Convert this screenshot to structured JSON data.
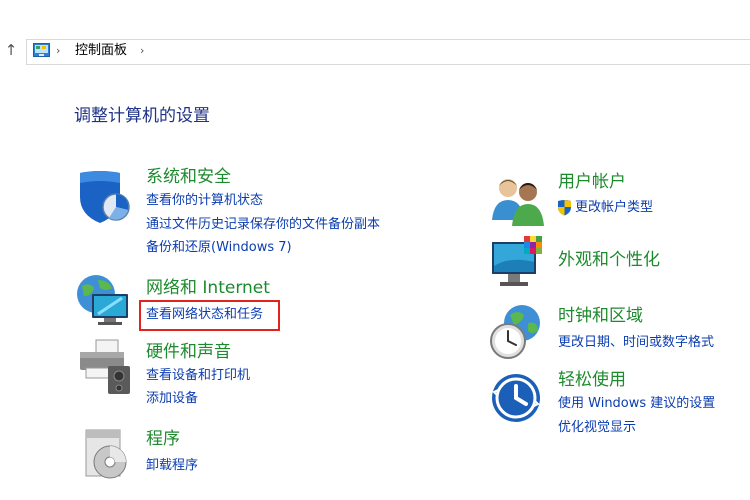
{
  "nav": {
    "breadcrumb": [
      "控制面板"
    ],
    "up_glyph": "↑",
    "separator_glyph": "›"
  },
  "page": {
    "title": "调整计算机的设置"
  },
  "categories": {
    "system_security": {
      "title": "系统和安全",
      "links": [
        "查看你的计算机状态",
        "通过文件历史记录保存你的文件备份副本",
        "备份和还原(Windows 7)"
      ]
    },
    "network": {
      "title": "网络和 Internet",
      "links": [
        "查看网络状态和任务"
      ]
    },
    "hardware": {
      "title": "硬件和声音",
      "links": [
        "查看设备和打印机",
        "添加设备"
      ]
    },
    "programs": {
      "title": "程序",
      "links": [
        "卸载程序"
      ]
    },
    "user_accounts": {
      "title": "用户帐户",
      "links": [
        "更改帐户类型"
      ]
    },
    "appearance": {
      "title": "外观和个性化",
      "links": []
    },
    "clock_region": {
      "title": "时钟和区域",
      "links": [
        "更改日期、时间或数字格式"
      ]
    },
    "ease_of_access": {
      "title": "轻松使用",
      "links": [
        "使用 Windows 建议的设置",
        "优化视觉显示"
      ]
    }
  },
  "colors": {
    "category_title": "#1e8a2e",
    "link": "#0b3db0",
    "heading": "#1e3287",
    "highlight_border": "#e0241c"
  }
}
